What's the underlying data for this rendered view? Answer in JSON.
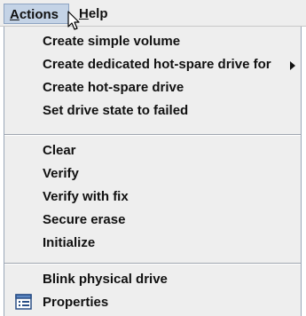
{
  "menubar": {
    "actions_mnemonic": "A",
    "actions_rest": "ctions",
    "help_mnemonic": "H",
    "help_rest": "elp"
  },
  "menu": {
    "items": [
      {
        "label": "Create simple volume"
      },
      {
        "label": "Create dedicated hot-spare drive for",
        "has_submenu": true
      },
      {
        "label": "Create hot-spare drive"
      },
      {
        "label": "Set drive state to failed"
      },
      {
        "label": "Clear"
      },
      {
        "label": "Verify"
      },
      {
        "label": "Verify with fix"
      },
      {
        "label": "Secure erase"
      },
      {
        "label": "Initialize"
      },
      {
        "label": "Blink physical drive"
      },
      {
        "label": "Properties",
        "icon": "properties-icon"
      }
    ]
  },
  "colors": {
    "menubar_bg": "#eeeeee",
    "active_menu_bg": "#c4d3e6",
    "active_menu_border": "#8da3c1",
    "menu_bg": "#eeeeee",
    "text": "#111111"
  }
}
